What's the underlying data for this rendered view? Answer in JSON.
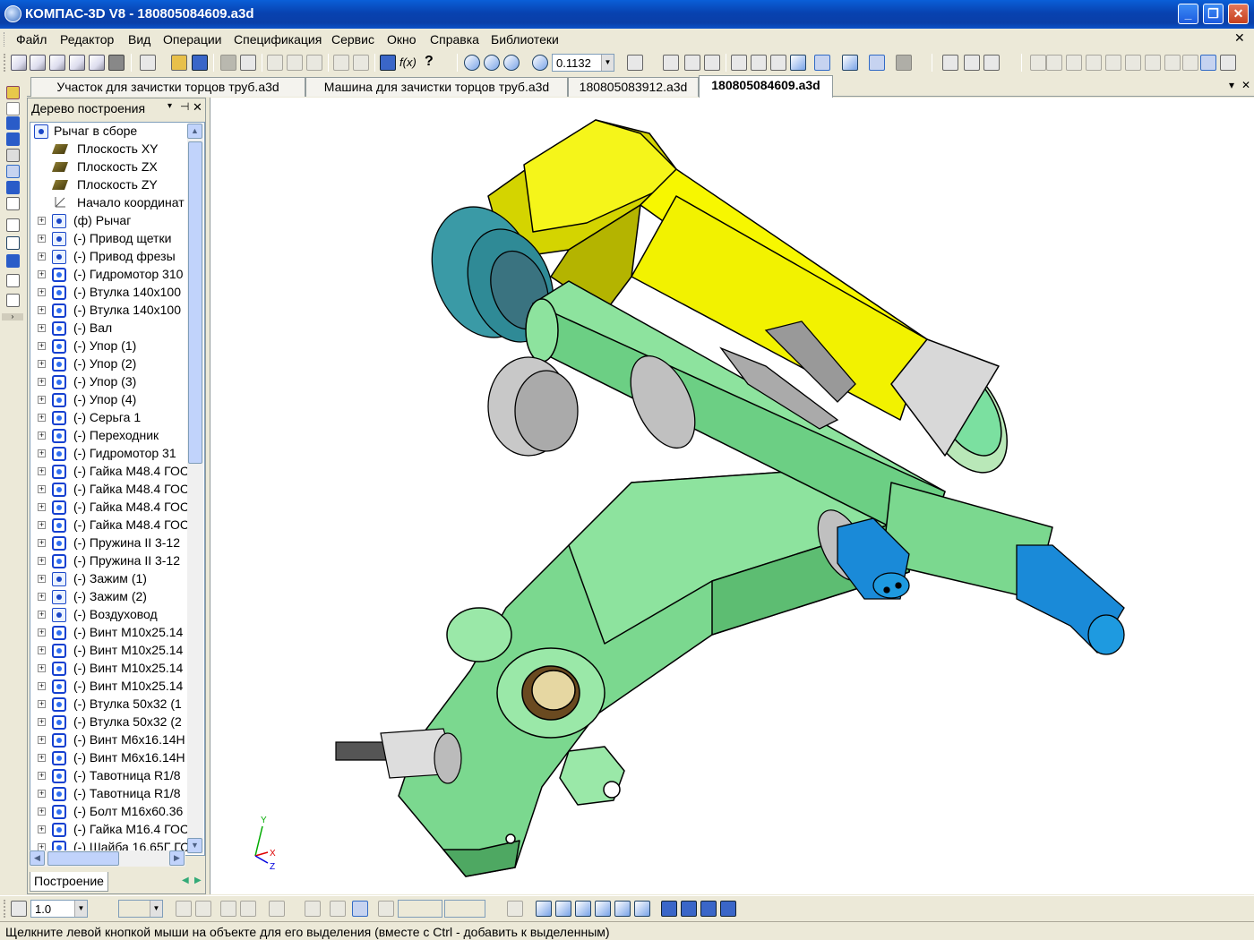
{
  "window": {
    "title": "КОМПАС-3D V8 - 180805084609.a3d"
  },
  "menu": [
    "Файл",
    "Редактор",
    "Вид",
    "Операции",
    "Спецификация",
    "Сервис",
    "Окно",
    "Справка",
    "Библиотеки"
  ],
  "toolbar": {
    "zoom_value": "0.1132"
  },
  "tabs": [
    {
      "label": "Участок для зачистки торцов труб.a3d",
      "active": false
    },
    {
      "label": "Машина для зачистки торцов труб.a3d",
      "active": false
    },
    {
      "label": "180805083912.a3d",
      "active": false
    },
    {
      "label": "180805084609.a3d",
      "active": true
    }
  ],
  "tree": {
    "header": "Дерево построения",
    "root": "Рычаг в сборе",
    "items": [
      {
        "label": "Плоскость XY",
        "type": "plane"
      },
      {
        "label": "Плоскость ZX",
        "type": "plane"
      },
      {
        "label": "Плоскость ZY",
        "type": "plane"
      },
      {
        "label": "Начало координат",
        "type": "origin"
      },
      {
        "label": "(ф) Рычаг",
        "type": "assembly"
      },
      {
        "label": "(-) Привод щетки",
        "type": "assembly"
      },
      {
        "label": "(-) Привод фрезы",
        "type": "assembly"
      },
      {
        "label": "(-) Гидромотор 310",
        "type": "part"
      },
      {
        "label": "(-) Втулка 140x100",
        "type": "part"
      },
      {
        "label": "(-) Втулка 140x100",
        "type": "part"
      },
      {
        "label": "(-) Вал",
        "type": "part"
      },
      {
        "label": "(-) Упор (1)",
        "type": "part"
      },
      {
        "label": "(-) Упор (2)",
        "type": "part"
      },
      {
        "label": "(-) Упор (3)",
        "type": "part"
      },
      {
        "label": "(-) Упор (4)",
        "type": "part"
      },
      {
        "label": "(-) Серьга 1",
        "type": "part"
      },
      {
        "label": "(-) Переходник",
        "type": "part"
      },
      {
        "label": "(-) Гидромотор  31",
        "type": "part"
      },
      {
        "label": "(-) Гайка M48.4 ГОС",
        "type": "part"
      },
      {
        "label": "(-) Гайка M48.4 ГОС",
        "type": "part"
      },
      {
        "label": "(-) Гайка M48.4 ГОС",
        "type": "part"
      },
      {
        "label": "(-) Гайка M48.4 ГОС",
        "type": "part"
      },
      {
        "label": "(-) Пружина II 3-12",
        "type": "part"
      },
      {
        "label": "(-) Пружина II 3-12",
        "type": "part"
      },
      {
        "label": "(-) Зажим (1)",
        "type": "assembly"
      },
      {
        "label": "(-) Зажим (2)",
        "type": "assembly"
      },
      {
        "label": "(-) Воздуховод",
        "type": "assembly"
      },
      {
        "label": "(-) Винт M10x25.14",
        "type": "part"
      },
      {
        "label": "(-) Винт M10x25.14",
        "type": "part"
      },
      {
        "label": "(-) Винт M10x25.14",
        "type": "part"
      },
      {
        "label": "(-) Винт M10x25.14",
        "type": "part"
      },
      {
        "label": "(-) Втулка 50x32 (1",
        "type": "part"
      },
      {
        "label": "(-) Втулка 50x32 (2",
        "type": "part"
      },
      {
        "label": "(-) Винт M6x16.14H",
        "type": "part"
      },
      {
        "label": "(-) Винт M6x16.14H",
        "type": "part"
      },
      {
        "label": "(-) Тавотница R1/8",
        "type": "part"
      },
      {
        "label": "(-) Тавотница R1/8",
        "type": "part"
      },
      {
        "label": "(-) Болт M16x60.36",
        "type": "part"
      },
      {
        "label": "(-) Гайка M16.4 ГОС",
        "type": "part"
      },
      {
        "label": "(-) Шайба 16.65Г ГС",
        "type": "part"
      }
    ],
    "bottom_tab": "Построение"
  },
  "axes": {
    "x": "X",
    "y": "Y",
    "z": "Z"
  },
  "bottom": {
    "step_value": "1.0"
  },
  "status": "Щелкните левой кнопкой мыши на объекте для его выделения (вместе с Ctrl - добавить к выделенным)",
  "colors": {
    "lever": "#6ed68a",
    "cylinder": "#f5f500",
    "motor": "#1a8ad8",
    "brush": "#2f8a9a"
  }
}
